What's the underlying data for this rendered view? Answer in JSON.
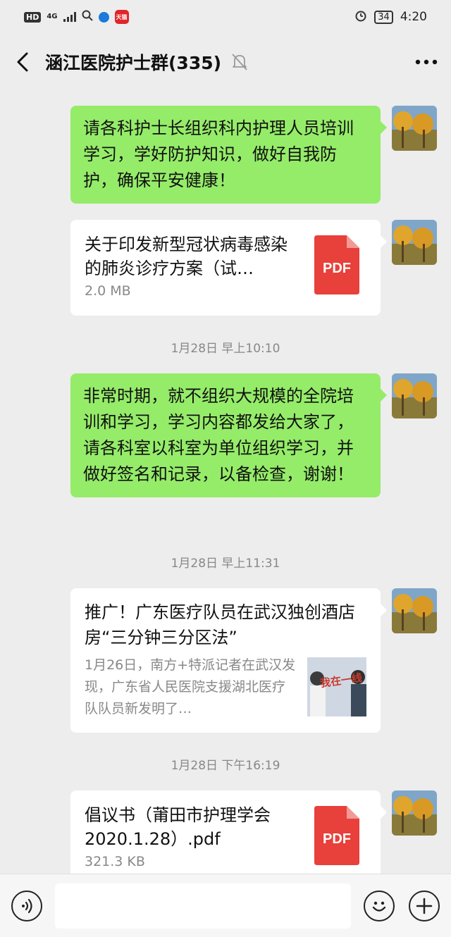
{
  "status_bar": {
    "hd": "HD",
    "network": "4G",
    "app_badge": "天猫",
    "battery": "34",
    "time": "4:20"
  },
  "nav": {
    "title": "涵江医院护士群(335)"
  },
  "messages": [
    {
      "type": "text",
      "text": "请各科护士长组织科内护理人员培训学习，学好防护知识，做好自我防护，确保平安健康！"
    },
    {
      "type": "file",
      "name": "关于印发新型冠状病毒感染的肺炎诊疗方案（试…",
      "size": "2.0 MB",
      "icon_label": "PDF"
    },
    {
      "type": "time",
      "text": "1月28日 早上10:10"
    },
    {
      "type": "text",
      "text": "非常时期，就不组织大规模的全院培训和学习，学习内容都发给大家了，请各科室以科室为单位组织学习，并做好签名和记录，以备检查，谢谢！"
    },
    {
      "type": "time",
      "text": "1月28日 早上11:31"
    },
    {
      "type": "link",
      "title": "推广！广东医疗队员在武汉独创酒店房“三分钟三分区法”",
      "desc": "1月26日，南方+特派记者在武汉发现，广东省人民医院支援湖北医疗队队员新发明了…",
      "thumb_text": "我在一线"
    },
    {
      "type": "time",
      "text": "1月28日 下午16:19"
    },
    {
      "type": "file",
      "name": "倡议书（莆田市护理学会2020.1.28）.pdf",
      "size": "321.3 KB",
      "icon_label": "PDF"
    }
  ],
  "colors": {
    "background": "#ededed",
    "self_bubble": "#95ec69",
    "pdf_red": "#e8403a"
  },
  "icons": [
    "back-arrow-icon",
    "mute-bell-icon",
    "more-icon",
    "voice-icon",
    "emoji-icon",
    "plus-icon"
  ]
}
